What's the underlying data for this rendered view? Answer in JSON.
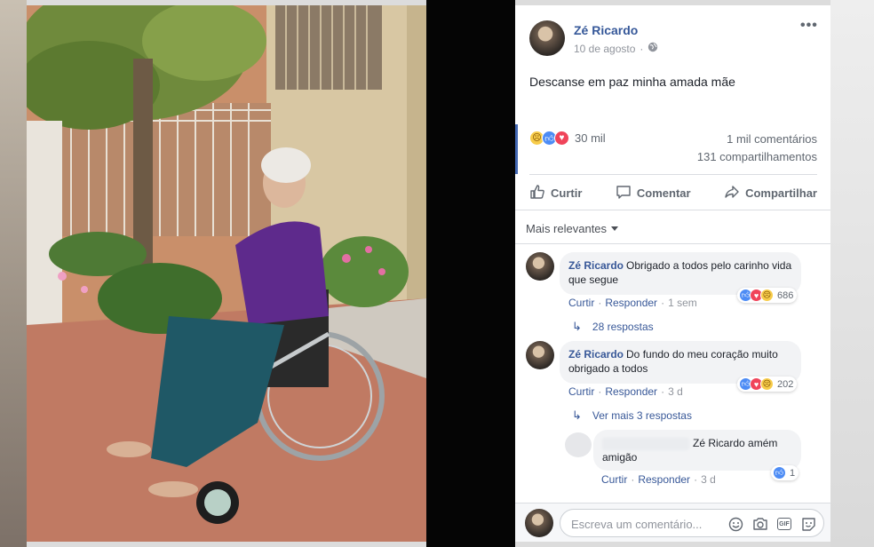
{
  "post": {
    "author": "Zé Ricardo",
    "date": "10 de agosto",
    "more": "•••",
    "text": "Descanse em paz minha amada mãe",
    "reaction_count": "30 mil",
    "comments_count": "1 mil comentários",
    "shares_count": "131 compartilhamentos"
  },
  "actions": {
    "like": "Curtir",
    "comment": "Comentar",
    "share": "Compartilhar"
  },
  "filter": {
    "label": "Mais relevantes"
  },
  "comments": [
    {
      "author": "Zé Ricardo",
      "text": "Obrigado a todos pelo carinho vida que segue",
      "like": "Curtir",
      "reply": "Responder",
      "time": "1 sem",
      "reactions": "686",
      "replies_link": "28 respostas"
    },
    {
      "author": "Zé Ricardo",
      "text": "Do fundo do meu coração muito obrigado a todos",
      "like": "Curtir",
      "reply": "Responder",
      "time": "3 d",
      "reactions": "202",
      "replies_link": "Ver mais 3 respostas"
    }
  ],
  "reply": {
    "text_line1": "Zé Ricardo amém",
    "text_line2": "amigão",
    "like": "Curtir",
    "reply": "Responder",
    "time": "3 d",
    "reactions": "1"
  },
  "composer": {
    "placeholder": "Escreva um comentário..."
  },
  "icons": {
    "globe": "globe-icon",
    "like": "thumbs-up-icon",
    "comment": "speech-bubble-icon",
    "share": "share-arrow-icon",
    "emoji": "smiley-icon",
    "camera": "camera-icon",
    "gif": "gif-icon",
    "sticker": "sticker-icon"
  },
  "colors": {
    "link": "#365899",
    "like_reaction": "#4d8cf5",
    "love_reaction": "#f0445a",
    "sad_reaction": "#f7cc4a"
  }
}
